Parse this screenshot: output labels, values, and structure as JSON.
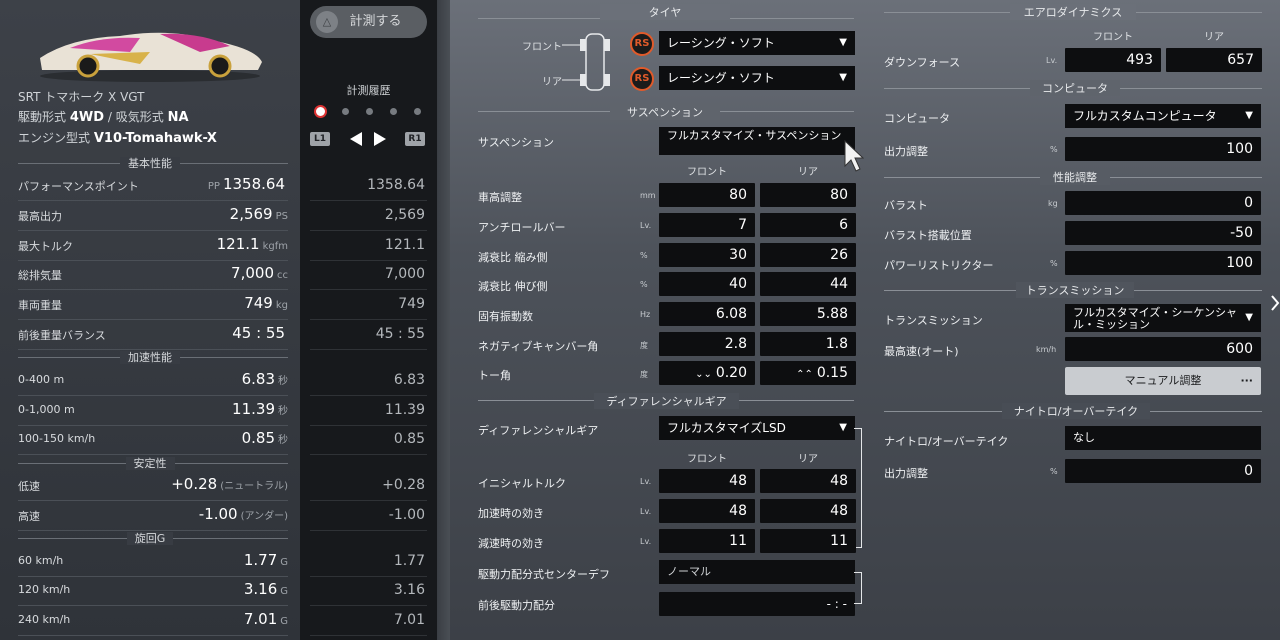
{
  "left": {
    "car_name": "SRT トマホーク X VGT",
    "drive_label": "駆動形式",
    "drive_value": "4WD",
    "sep": "/",
    "intake_label": "吸気形式",
    "intake_value": "NA",
    "engine_label": "エンジン型式",
    "engine_value": "V10-Tomahawk-X",
    "sections": {
      "basic": "基本性能",
      "accel": "加速性能",
      "stability": "安定性",
      "turning": "旋回G"
    },
    "rows": [
      {
        "label": "パフォーマンスポイント",
        "pre": "PP",
        "value": "1358.64",
        "unit": "",
        "hist": "1358.64"
      },
      {
        "label": "最高出力",
        "pre": "",
        "value": "2,569",
        "unit": "PS",
        "hist": "2,569"
      },
      {
        "label": "最大トルク",
        "pre": "",
        "value": "121.1",
        "unit": "kgfm",
        "hist": "121.1"
      },
      {
        "label": "総排気量",
        "pre": "",
        "value": "7,000",
        "unit": "cc",
        "hist": "7,000"
      },
      {
        "label": "車両重量",
        "pre": "",
        "value": "749",
        "unit": "kg",
        "hist": "749"
      },
      {
        "label": "前後重量バランス",
        "pre": "",
        "value": "45 : 55",
        "unit": "",
        "hist": "45 : 55"
      },
      {
        "label": "0-400 m",
        "pre": "",
        "value": "6.83",
        "unit": "秒",
        "hist": "6.83"
      },
      {
        "label": "0-1,000 m",
        "pre": "",
        "value": "11.39",
        "unit": "秒",
        "hist": "11.39"
      },
      {
        "label": "100-150 km/h",
        "pre": "",
        "value": "0.85",
        "unit": "秒",
        "hist": "0.85"
      },
      {
        "label": "低速",
        "pre": "",
        "value": "+0.28",
        "unit": "(ニュートラル)",
        "hist": "+0.28"
      },
      {
        "label": "高速",
        "pre": "",
        "value": "-1.00",
        "unit": "(アンダー)",
        "hist": "-1.00"
      },
      {
        "label": "60 km/h",
        "pre": "",
        "value": "1.77",
        "unit": "G",
        "hist": "1.77"
      },
      {
        "label": "120 km/h",
        "pre": "",
        "value": "3.16",
        "unit": "G",
        "hist": "3.16"
      },
      {
        "label": "240 km/h",
        "pre": "",
        "value": "7.01",
        "unit": "G",
        "hist": "7.01"
      }
    ]
  },
  "mid": {
    "measure_button": "計測する",
    "button_icon": "△",
    "history_title": "計測履歴",
    "l1": "L1",
    "r1": "R1"
  },
  "tire": {
    "title": "タイヤ",
    "front_label": "フロント",
    "rear_label": "リア",
    "badge": "RS",
    "front_value": "レーシング・ソフト",
    "rear_value": "レーシング・ソフト"
  },
  "suspension": {
    "title": "サスペンション",
    "label": "サスペンション",
    "value": "フルカスタマイズ・サスペンション",
    "col_front": "フロント",
    "col_rear": "リア",
    "rows": [
      {
        "label": "車高調整",
        "unit": "mm",
        "front": "80",
        "rear": "80"
      },
      {
        "label": "アンチロールバー",
        "unit": "Lv.",
        "front": "7",
        "rear": "6"
      },
      {
        "label": "減衰比 縮み側",
        "unit": "%",
        "front": "30",
        "rear": "26"
      },
      {
        "label": "減衰比 伸び側",
        "unit": "%",
        "front": "40",
        "rear": "44"
      },
      {
        "label": "固有振動数",
        "unit": "Hz",
        "front": "6.08",
        "rear": "5.88"
      },
      {
        "label": "ネガティブキャンバー角",
        "unit": "度",
        "front": "2.8",
        "rear": "1.8"
      },
      {
        "label": "トー角",
        "unit": "度",
        "front": "0.20",
        "rear": "0.15"
      }
    ]
  },
  "differential": {
    "title": "ディファレンシャルギア",
    "label": "ディファレンシャルギア",
    "value": "フルカスタマイズLSD",
    "col_front": "フロント",
    "col_rear": "リア",
    "rows": [
      {
        "label": "イニシャルトルク",
        "unit": "Lv.",
        "front": "48",
        "rear": "48"
      },
      {
        "label": "加速時の効き",
        "unit": "Lv.",
        "front": "48",
        "rear": "48"
      },
      {
        "label": "減速時の効き",
        "unit": "Lv.",
        "front": "11",
        "rear": "11"
      }
    ],
    "center_label": "駆動力配分式センターデフ",
    "center_value": "ノーマル",
    "split_label": "前後駆動力配分",
    "split_value": "- : -"
  },
  "aero": {
    "title": "エアロダイナミクス",
    "col_front": "フロント",
    "col_rear": "リア",
    "label": "ダウンフォース",
    "unit": "Lv.",
    "front": "493",
    "rear": "657"
  },
  "computer": {
    "title": "コンピュータ",
    "label": "コンピュータ",
    "value": "フルカスタムコンピュータ",
    "output_label": "出力調整",
    "output_unit": "%",
    "output_value": "100"
  },
  "performance": {
    "title": "性能調整",
    "ballast_label": "バラスト",
    "ballast_unit": "kg",
    "ballast_value": "0",
    "pos_label": "バラスト搭載位置",
    "pos_value": "-50",
    "restrictor_label": "パワーリストリクター",
    "restrictor_unit": "%",
    "restrictor_value": "100"
  },
  "transmission": {
    "title": "トランスミッション",
    "label": "トランスミッション",
    "value": "フルカスタマイズ・シーケンシャル・ミッション",
    "top_label": "最高速(オート)",
    "top_unit": "km/h",
    "top_value": "600",
    "manual_button": "マニュアル調整",
    "more": "···"
  },
  "nitro": {
    "title": "ナイトロ/オーバーテイク",
    "label": "ナイトロ/オーバーテイク",
    "value": "なし",
    "output_label": "出力調整",
    "output_unit": "%",
    "output_value": "0"
  },
  "colors": {
    "accent_badge": "#e05a2a",
    "record_dot": "#dd3333"
  }
}
